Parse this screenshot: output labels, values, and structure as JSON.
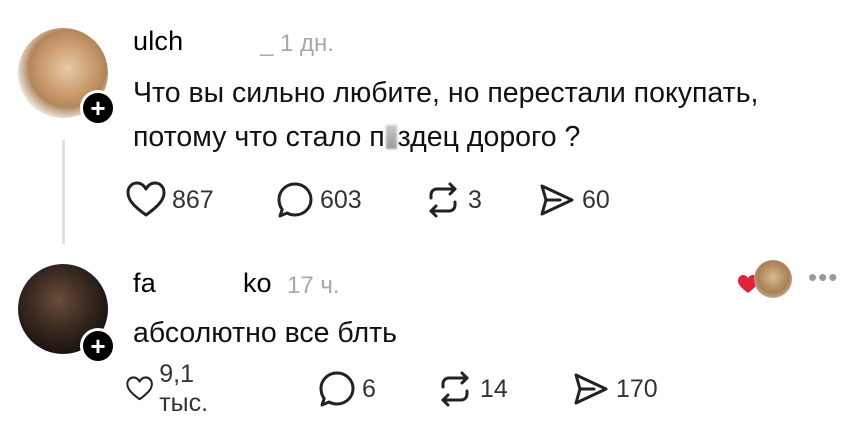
{
  "posts": [
    {
      "username": "ulch",
      "timestamp": "_ 1 дн.",
      "text_line1": "Что вы сильно любите, но перестали покупать,",
      "text_line2_a": "потому что стало п",
      "text_line2_b": "здец дорого ?",
      "likes": "867",
      "comments": "603",
      "reposts": "3",
      "shares": "60"
    },
    {
      "username_a": "fa",
      "username_b": "ko",
      "timestamp": "17 ч.",
      "text": "абсолютно все блть",
      "likes": "9,1 тыс.",
      "comments": "6",
      "reposts": "14",
      "shares": "170",
      "more": "•••"
    }
  ],
  "icons": {
    "like": "heart-outline-icon",
    "comment": "speech-bubble-icon",
    "repost": "repost-arrows-icon",
    "share": "send-icon",
    "liked_by_author": "red-heart-icon",
    "follow": "plus-icon"
  },
  "colors": {
    "text": "#111111",
    "muted": "#a8a8a8",
    "heart_red": "#e0223a"
  }
}
